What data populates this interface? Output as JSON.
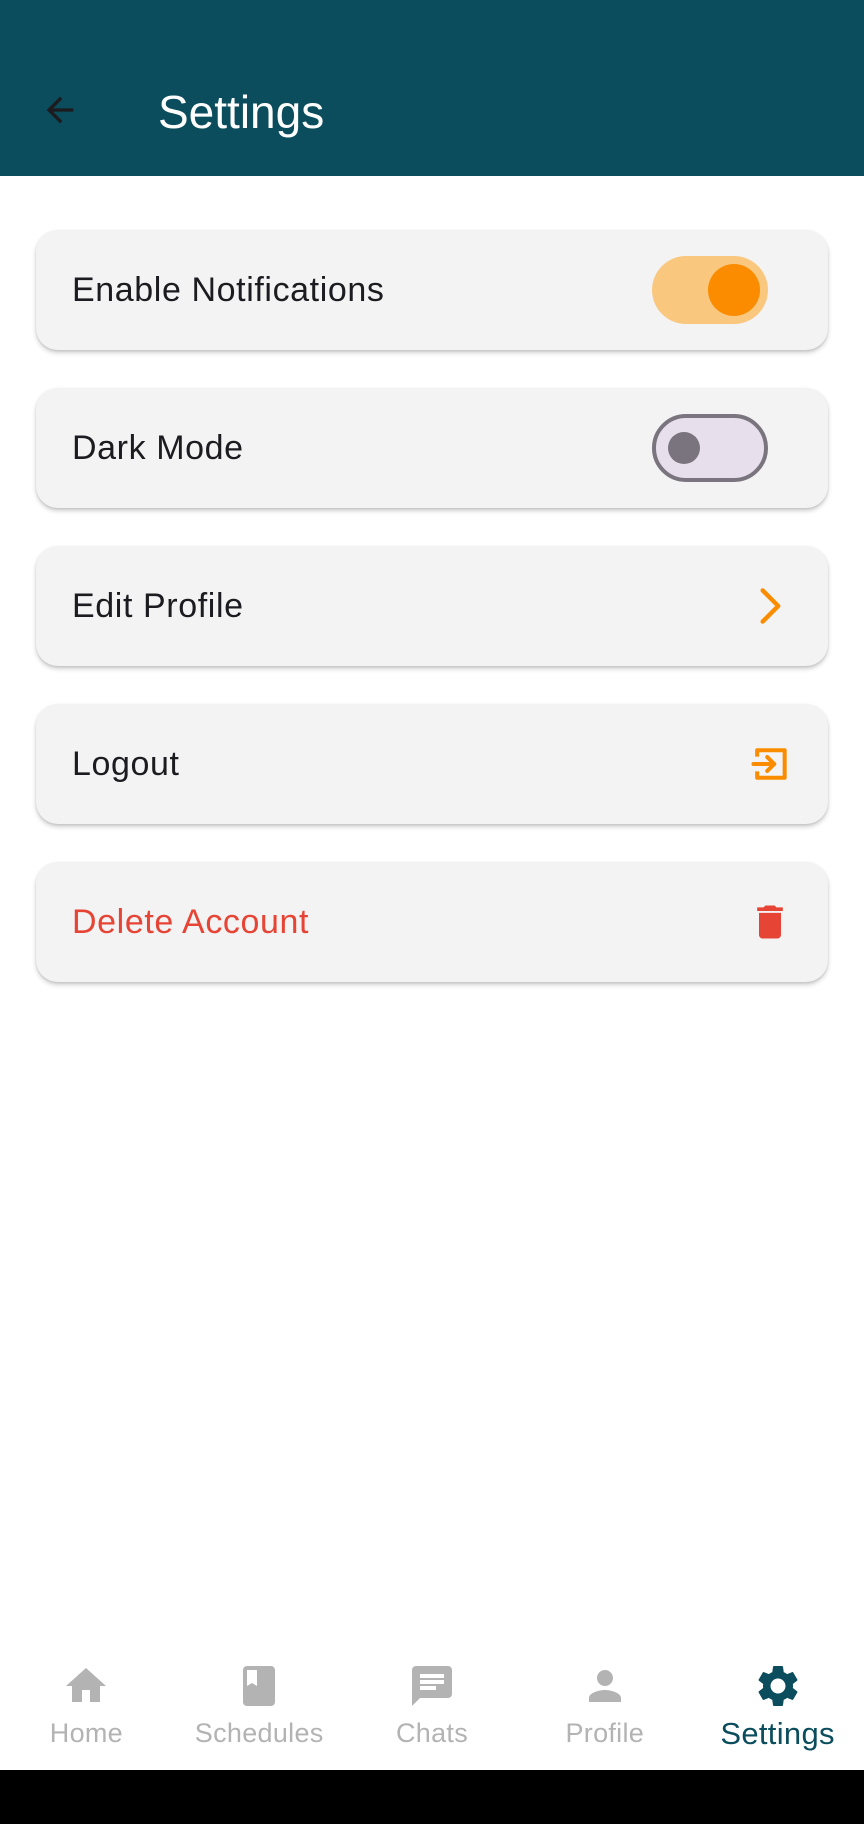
{
  "appbar": {
    "title": "Settings",
    "back_icon": "arrow-left-icon",
    "background": "#0b4d5c"
  },
  "settings": {
    "notifications": {
      "label": "Enable Notifications",
      "enabled": true
    },
    "dark_mode": {
      "label": "Dark Mode",
      "enabled": false
    },
    "edit_profile": {
      "label": "Edit Profile",
      "icon": "chevron-right-icon"
    },
    "logout": {
      "label": "Logout",
      "icon": "logout-icon"
    },
    "delete_account": {
      "label": "Delete Account",
      "icon": "trash-icon"
    }
  },
  "bottom_nav": {
    "items": [
      {
        "label": "Home",
        "icon": "home-icon",
        "active": false
      },
      {
        "label": "Schedules",
        "icon": "book-icon",
        "active": false
      },
      {
        "label": "Chats",
        "icon": "chat-icon",
        "active": false
      },
      {
        "label": "Profile",
        "icon": "person-icon",
        "active": false
      },
      {
        "label": "Settings",
        "icon": "gear-icon",
        "active": true
      }
    ]
  },
  "colors": {
    "primary": "#0b4d5c",
    "accent": "#fb8c00",
    "danger": "#e64535",
    "inactive": "#b3b3b3"
  }
}
